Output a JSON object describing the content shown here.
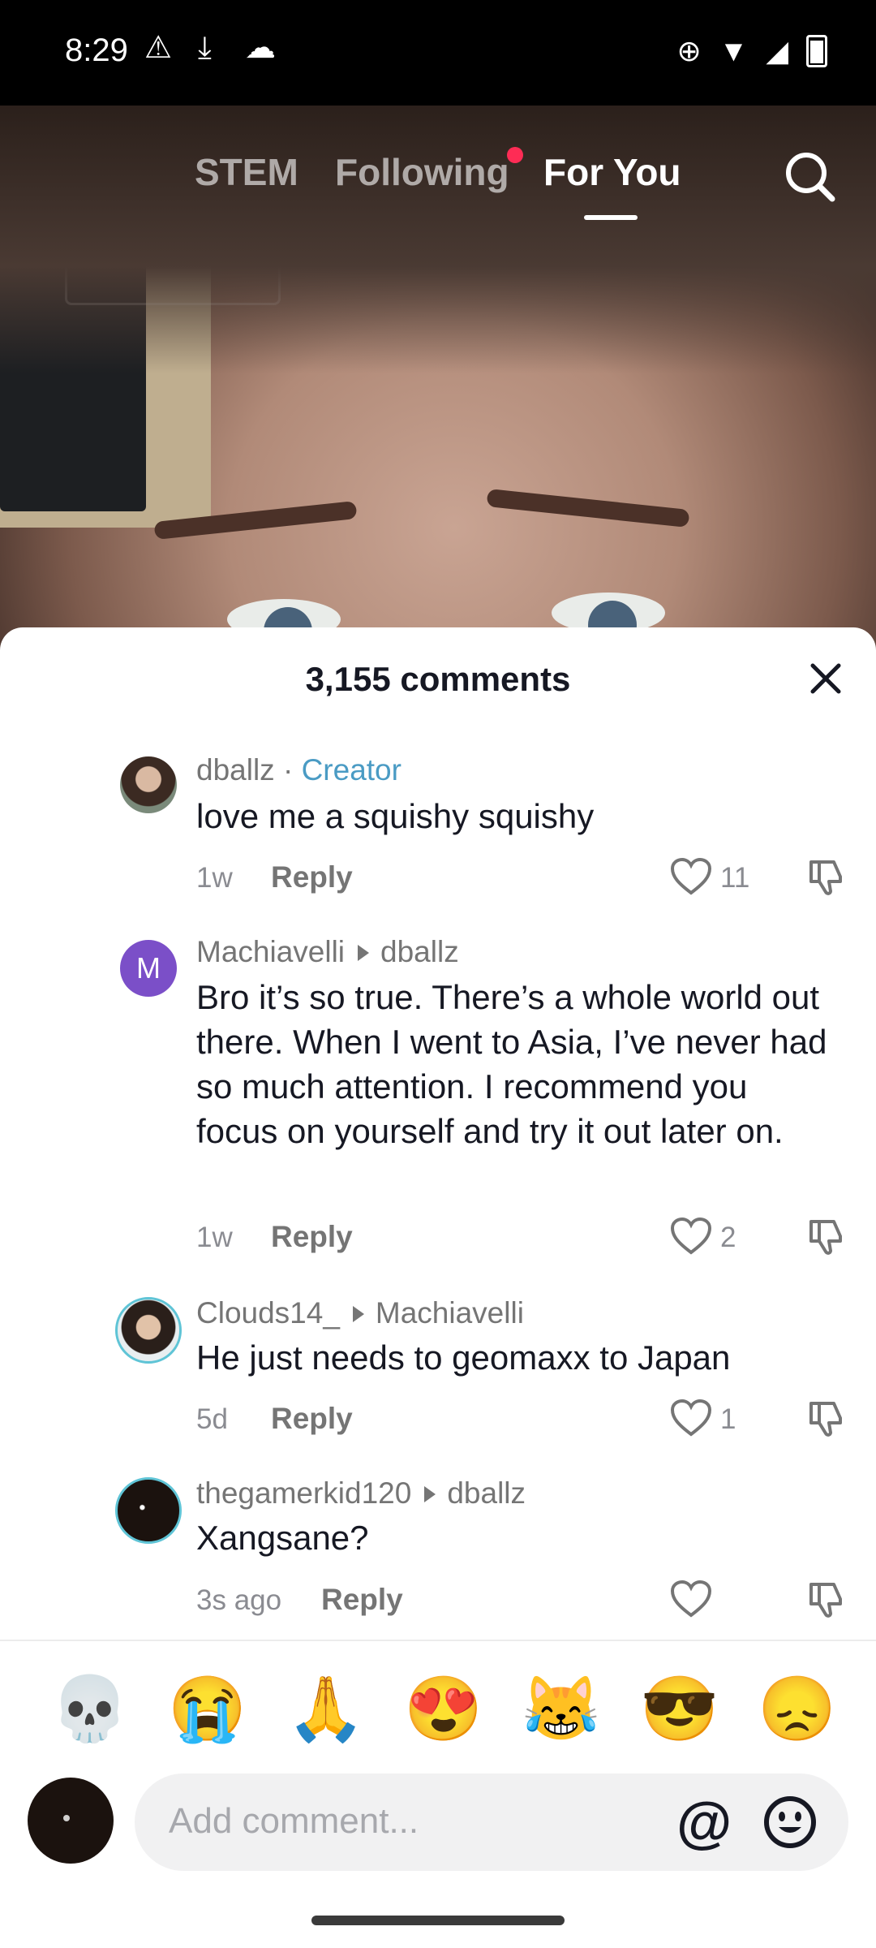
{
  "status_bar": {
    "time": "8:29"
  },
  "top_nav": {
    "tabs": [
      {
        "label": "STEM"
      },
      {
        "label": "Following"
      },
      {
        "label": "For You"
      }
    ],
    "active_tab": "For You"
  },
  "comments_sheet": {
    "title": "3,155 comments",
    "comments": [
      {
        "username": "dballz",
        "badge": "Creator",
        "text": "love me a squishy squishy",
        "age": "1w",
        "reply_label": "Reply",
        "likes": "11"
      },
      {
        "username": "Machiavelli",
        "avatar_letter": "M",
        "reply_to": "dballz",
        "text": "Bro it’s so true. There’s a whole world out there. When I went to Asia, I’ve never had so much attention. I recommend you focus on yourself and try it out later on.",
        "age": "1w",
        "reply_label": "Reply",
        "likes": "2"
      },
      {
        "username": "Clouds14_",
        "reply_to": "Machiavelli",
        "text": "He just needs to geomaxx to Japan",
        "age": "5d",
        "reply_label": "Reply",
        "likes": "1"
      },
      {
        "username": "thegamerkid120",
        "reply_to": "dballz",
        "text": "Xangsane?",
        "age": "3s ago",
        "reply_label": "Reply"
      }
    ]
  },
  "quick_emojis": [
    "💀",
    "😭",
    "🙏",
    "😍",
    "😹",
    "😎",
    "😞"
  ],
  "composer": {
    "placeholder": "Add comment...",
    "mention_symbol": "@"
  },
  "colors": {
    "accent_dot": "#fe2c55",
    "creator_badge": "#4a9bc4",
    "avatar_machiavelli": "#7b4fc8"
  }
}
